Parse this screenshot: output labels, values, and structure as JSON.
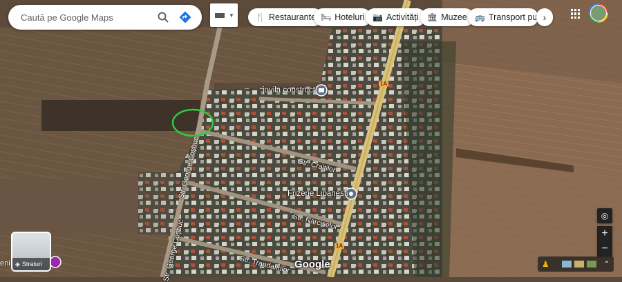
{
  "search": {
    "placeholder": "Caută pe Google Maps",
    "search_icon": "search-icon",
    "directions_icon": "directions-icon"
  },
  "layer_switch_icon": "map-layer-toggle-icon",
  "categories": [
    {
      "label": "Restaurante",
      "icon": "restaurant-icon"
    },
    {
      "label": "Hoteluri",
      "icon": "hotel-icon"
    },
    {
      "label": "Activități",
      "icon": "camera-icon"
    },
    {
      "label": "Muzee",
      "icon": "museum-icon"
    },
    {
      "label": "Transport public",
      "icon": "transit-icon"
    }
  ],
  "places": {
    "jovila": "jovila construct",
    "frizerie": "Frizerie Lipanesti"
  },
  "streets": {
    "george_cosbuc": "Str. George Coșbuc",
    "craitelor": "Str. Craiților",
    "narciselor": "Str. Narciselor",
    "trandafirilor": "Str. Trandafirilor"
  },
  "road_shield": "1A",
  "layers_label": "Straturi",
  "left_edge_text": "eni",
  "google_logo": "Google",
  "colors": {
    "accent_blue": "#1a73e8",
    "highlight_circle": "#2ecc40",
    "road": "#d8c27a"
  }
}
